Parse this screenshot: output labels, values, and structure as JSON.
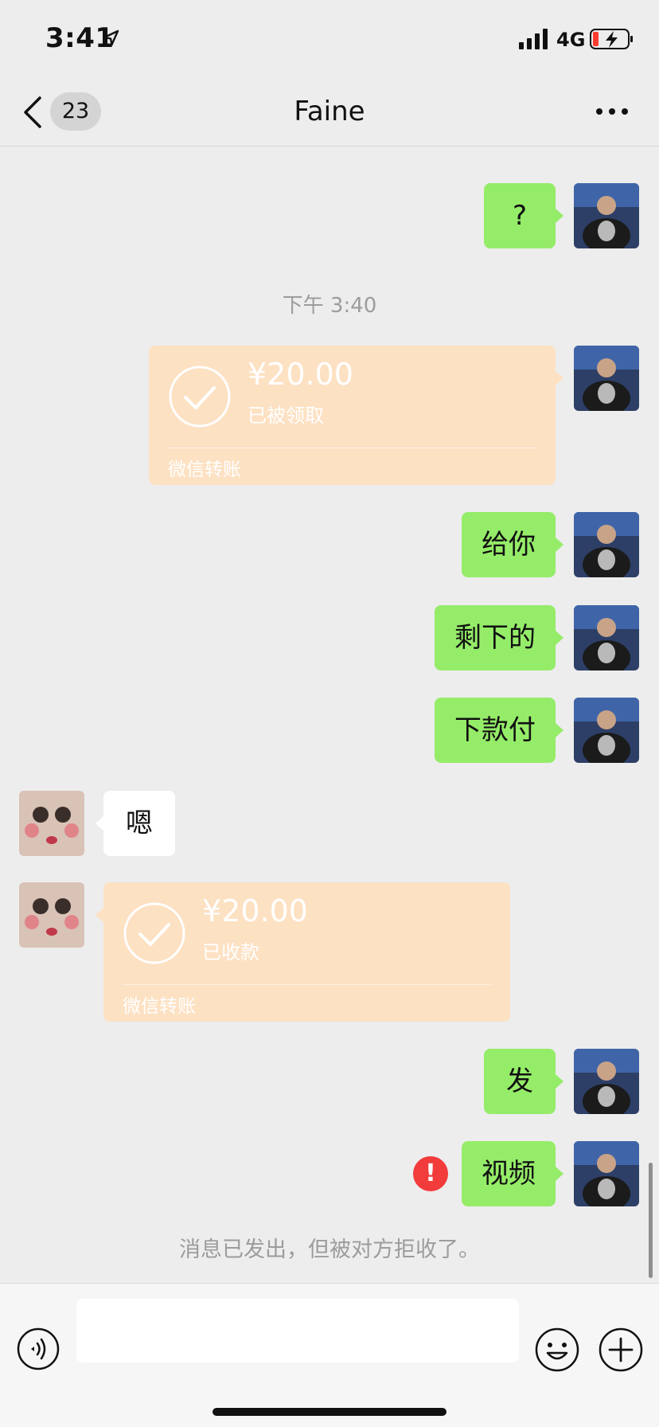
{
  "status_bar": {
    "time": "3:41",
    "network": "4G",
    "icons": [
      "location-arrow-icon",
      "cellular-signal-icon",
      "battery-charging-icon"
    ]
  },
  "nav": {
    "back_icon": "chevron-left-icon",
    "unread_count": "23",
    "title": "Faine",
    "more_icon": "ellipsis-icon"
  },
  "messages": {
    "q_mark": "?",
    "timestamp": "下午 3:40",
    "transfer_sent": {
      "amount": "¥20.00",
      "state": "已被领取",
      "label": "微信转账"
    },
    "give_you": "给你",
    "remaining": "剩下的",
    "next_payment": "下款付",
    "received_reply": "嗯",
    "transfer_received": {
      "amount": "¥20.00",
      "state": "已收款",
      "label": "微信转账"
    },
    "send": "发",
    "video": "视频",
    "error_mark": "!"
  },
  "system_note": "消息已发出，但被对方拒收了。",
  "input_bar": {
    "placeholder": "",
    "icons": [
      "voice-icon",
      "emoji-icon",
      "plus-icon"
    ]
  },
  "colors": {
    "background": "#ededed",
    "bubble_green": "#95ec69",
    "transfer_orange": "#fde1c3",
    "error_red": "#f23b3b"
  }
}
